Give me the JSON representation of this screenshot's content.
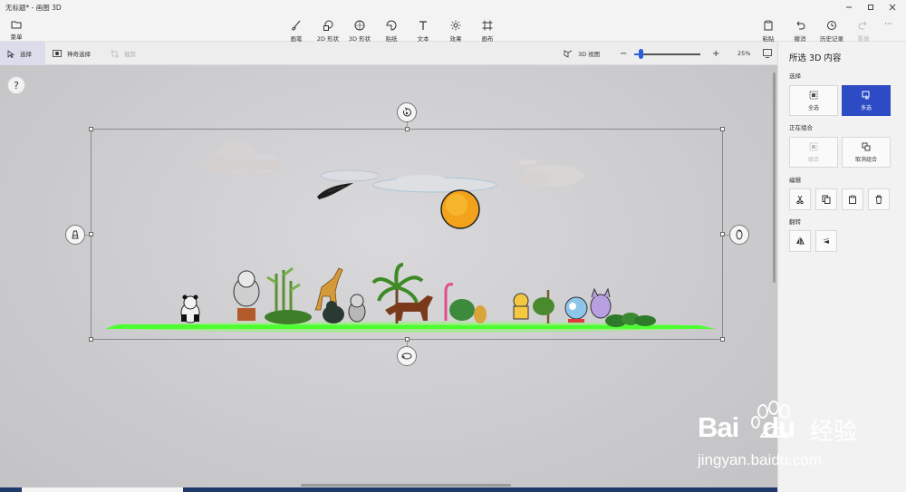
{
  "window": {
    "title": "无标题* - 画图 3D",
    "controls": [
      "minimize-icon",
      "maximize-icon",
      "close-icon"
    ]
  },
  "toolbar": {
    "menu_label": "菜单",
    "tools": [
      {
        "label": "画笔",
        "icon": "brush-icon"
      },
      {
        "label": "2D 形状",
        "icon": "shape-2d-icon"
      },
      {
        "label": "3D 形状",
        "icon": "shape-3d-icon"
      },
      {
        "label": "贴纸",
        "icon": "sticker-icon"
      },
      {
        "label": "文本",
        "icon": "text-icon"
      },
      {
        "label": "效果",
        "icon": "effects-icon"
      },
      {
        "label": "画布",
        "icon": "canvas-icon"
      }
    ],
    "right": [
      {
        "label": "粘贴",
        "icon": "paste-icon"
      },
      {
        "label": "撤消",
        "icon": "undo-icon"
      },
      {
        "label": "历史记录",
        "icon": "history-icon"
      },
      {
        "label": "重做",
        "icon": "redo-icon"
      }
    ],
    "more": "···"
  },
  "subbar": {
    "select_label": "选择",
    "magic_select_label": "神奇选择",
    "crop_label": "裁剪",
    "view3d_label": "3D 视图",
    "zoom_minus": "−",
    "zoom_plus": "+",
    "zoom_value": "25%",
    "zoom_fraction": 0.1
  },
  "canvas": {
    "help_label": "?"
  },
  "panel": {
    "title": "所选 3D 内容",
    "select_section": "选择",
    "select_all_label": "全选",
    "multi_select_label": "多选",
    "group_section": "正在组合",
    "group_label": "组合",
    "ungroup_label": "取消组合",
    "edit_section": "编辑",
    "edit_icons": [
      "cut-icon",
      "copy-icon",
      "paste-icon",
      "delete-icon"
    ],
    "flip_section": "翻转",
    "flip_icons": [
      "flip-horizontal-icon",
      "flip-vertical-icon"
    ]
  },
  "watermark": {
    "brand": "Bai",
    "brand2": "du",
    "cn": "经验",
    "url": "jingyan.baidu.com"
  },
  "colors": {
    "accent": "#2d4bc4",
    "grass": "#4cff2e",
    "sun": "#f2a21b",
    "watermark": "#ffffff"
  }
}
